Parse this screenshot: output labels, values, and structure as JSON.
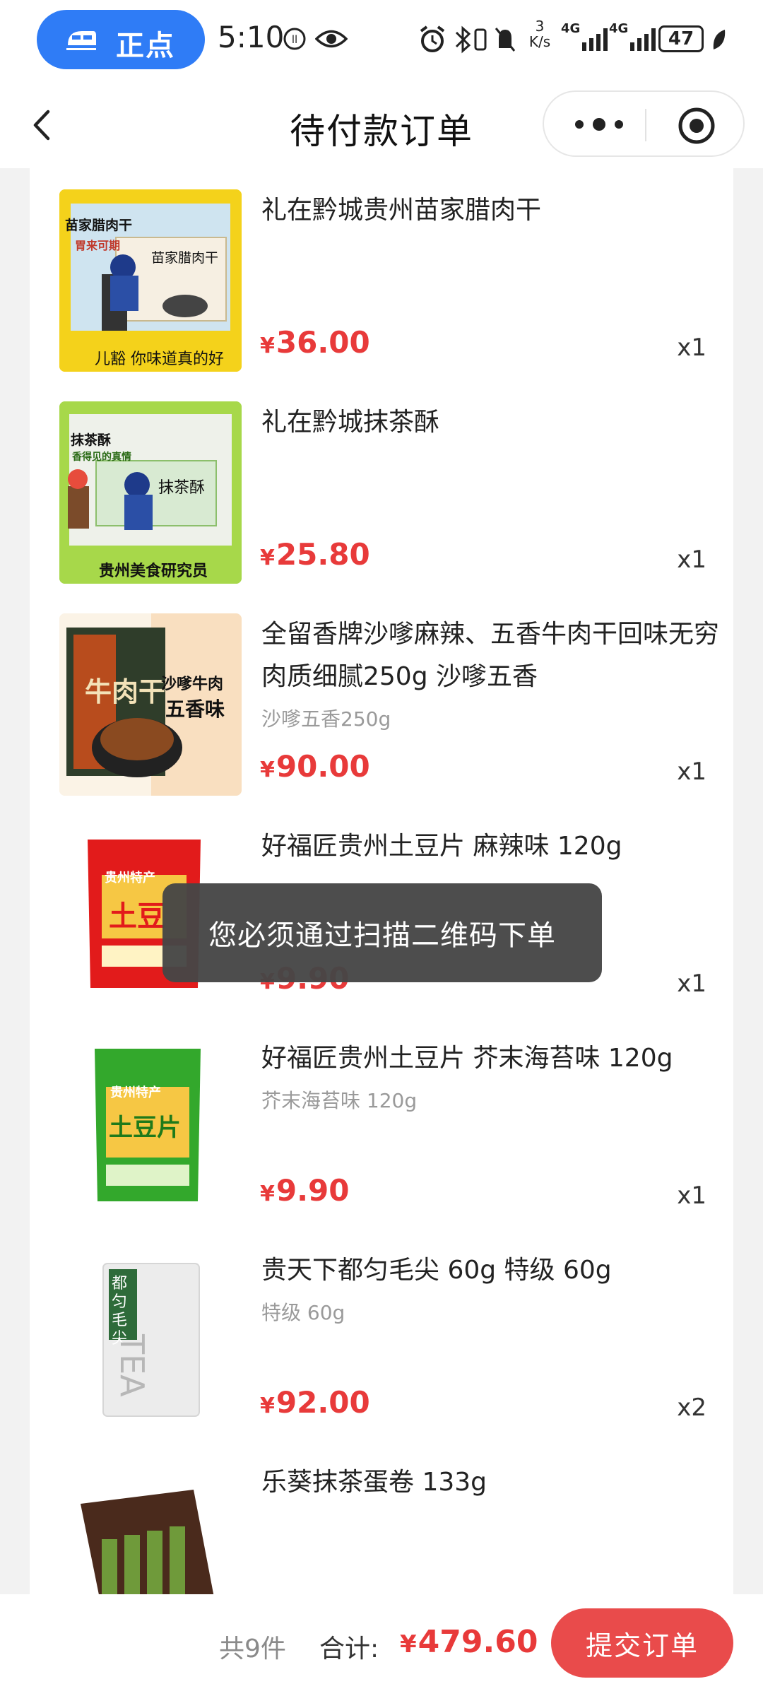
{
  "status_bar": {
    "pill_label": "正点",
    "time": "5:10",
    "net_speed_value": "3",
    "net_speed_unit": "K/s",
    "network_1": "4G",
    "network_2": "4G",
    "battery": "47"
  },
  "header": {
    "title": "待付款订单"
  },
  "items": [
    {
      "name": "礼在黔城贵州苗家腊肉干",
      "variant": "",
      "currency": "¥",
      "price": "36.00",
      "qty": "x1",
      "image_text": {
        "t1": "苗家腊肉干",
        "t2": "胃来可期",
        "t3": "苗家腊肉干",
        "t4": "儿豁 你味道真的好"
      }
    },
    {
      "name": "礼在黔城抹茶酥",
      "variant": "",
      "currency": "¥",
      "price": "25.80",
      "qty": "x1",
      "image_text": {
        "t1": "抹茶酥",
        "t2": "香得见的真情",
        "t3": "抹茶酥",
        "t4": "贵州美食研究员"
      }
    },
    {
      "name": "全留香牌沙嗲麻辣、五香牛肉干回味无穷肉质细腻250g 沙嗲五香",
      "variant": "沙嗲五香250g",
      "currency": "¥",
      "price": "90.00",
      "qty": "x1",
      "image_text": {
        "t1": "沙嗲牛肉",
        "t2": "五香味",
        "t3": "牛肉干"
      }
    },
    {
      "name": "好福匠贵州土豆片 麻辣味 120g",
      "variant": "",
      "currency": "¥",
      "price": "9.90",
      "qty": "x1",
      "image_text": {
        "t1": "贵州特产",
        "t2": "土豆"
      }
    },
    {
      "name": "好福匠贵州土豆片 芥末海苔味 120g",
      "variant": "芥末海苔味 120g",
      "currency": "¥",
      "price": "9.90",
      "qty": "x1",
      "image_text": {
        "t1": "贵州特产",
        "t2": "土豆片"
      }
    },
    {
      "name": "贵天下都匀毛尖 60g 特级 60g",
      "variant": "特级 60g",
      "currency": "¥",
      "price": "92.00",
      "qty": "x2",
      "image_text": {
        "t1": "都匀毛尖",
        "t2": "TEA"
      }
    },
    {
      "name": "乐葵抹茶蛋卷 133g",
      "variant": "",
      "currency": "¥",
      "price": "",
      "qty": "",
      "image_text": {}
    }
  ],
  "toast": "您必须通过扫描二维码下单",
  "footer": {
    "count": "共9件",
    "sum_label": "合计:",
    "currency": "¥",
    "total": "479.60",
    "submit": "提交订单"
  },
  "colors": {
    "accent_blue": "#2f7cf6",
    "price_red": "#e83a3a",
    "submit_red": "#e94b4b",
    "background": "#f2f2f2"
  }
}
